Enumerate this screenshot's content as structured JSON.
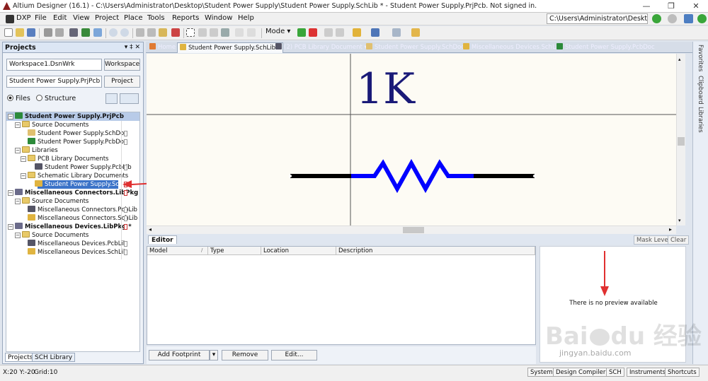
{
  "window": {
    "title": "Altium Designer (16.1) - C:\\Users\\Administrator\\Desktop\\Student Power Supply\\Student Power Supply.SchLib * - Student Power Supply.PrjPcb. Not signed in.",
    "controls": [
      "—",
      "❐",
      "✕"
    ]
  },
  "menu": {
    "items": [
      "DXP",
      "File",
      "Edit",
      "View",
      "Project",
      "Place",
      "Tools",
      "Reports",
      "Window",
      "Help"
    ],
    "path": "C:\\Users\\Administrator\\Desktop\\"
  },
  "toolbar": {
    "mode_label": "Mode ▾"
  },
  "projects_panel": {
    "title": "Projects",
    "header_controls": "▾ ‡ ✕",
    "workspace_value": "Workspace1.DsnWrk",
    "workspace_button": "Workspace",
    "project_value": "Student Power Supply.PrjPcb",
    "project_button": "Project",
    "radio_files": "Files",
    "radio_structure": "Structure",
    "tree": {
      "n0": "Student Power Supply.PrjPcb",
      "n1": "Source Documents",
      "n2": "Student Power Supply.SchDoc",
      "n3": "Student Power Supply.PcbDoc",
      "n4": "Libraries",
      "n5": "PCB Library Documents",
      "n6": "Student Power Supply.PcbLib",
      "n7": "Schematic Library Documents",
      "n8": "Student Power Supply.SchLib",
      "n9": "Miscellaneous Connectors.LibPkg",
      "n10": "Source Documents",
      "n11": "Miscellaneous Connectors.PcbLib",
      "n12": "Miscellaneous Connectors.SchLib",
      "n13": "Miscellaneous Devices.LibPkg *",
      "n14": "Source Documents",
      "n15": "Miscellaneous Devices.PcbLib",
      "n16": "Miscellaneous Devices.SchLib"
    },
    "bottom_tabs": [
      "Projects",
      "SCH Library"
    ]
  },
  "doc_tabs": [
    "Home",
    "Student Power Supply.SchLib *",
    "(2) PCB Library Document",
    "Student Power Supply.SchDoc",
    "Miscellaneous Devices.SchLib",
    "Student Power Supply.PcbDoc"
  ],
  "canvas": {
    "component_label": "1K",
    "colors": {
      "background": "#fdfbf4",
      "resistor_body": "#0000ff",
      "pins": "#000000",
      "label": "#1a1a78"
    }
  },
  "side_tabs": [
    "Favorites",
    "Clipboard",
    "Libraries"
  ],
  "editor": {
    "tab_label": "Editor",
    "mask_level": "Mask Level",
    "clear": "Clear",
    "columns": [
      "Model",
      "Type",
      "Location",
      "Description"
    ],
    "preview_message": "There is no preview available",
    "add_footprint": "Add Footprint",
    "remove": "Remove",
    "edit": "Edit..."
  },
  "status_bar": {
    "coords": "X:20 Y:-20",
    "grid": "Grid:10",
    "buttons": [
      "System",
      "Design Compiler",
      "SCH",
      "Instruments",
      "Shortcuts"
    ]
  },
  "watermark": {
    "logo_text": "Bai du 经验",
    "url": "jingyan.baidu.com"
  }
}
